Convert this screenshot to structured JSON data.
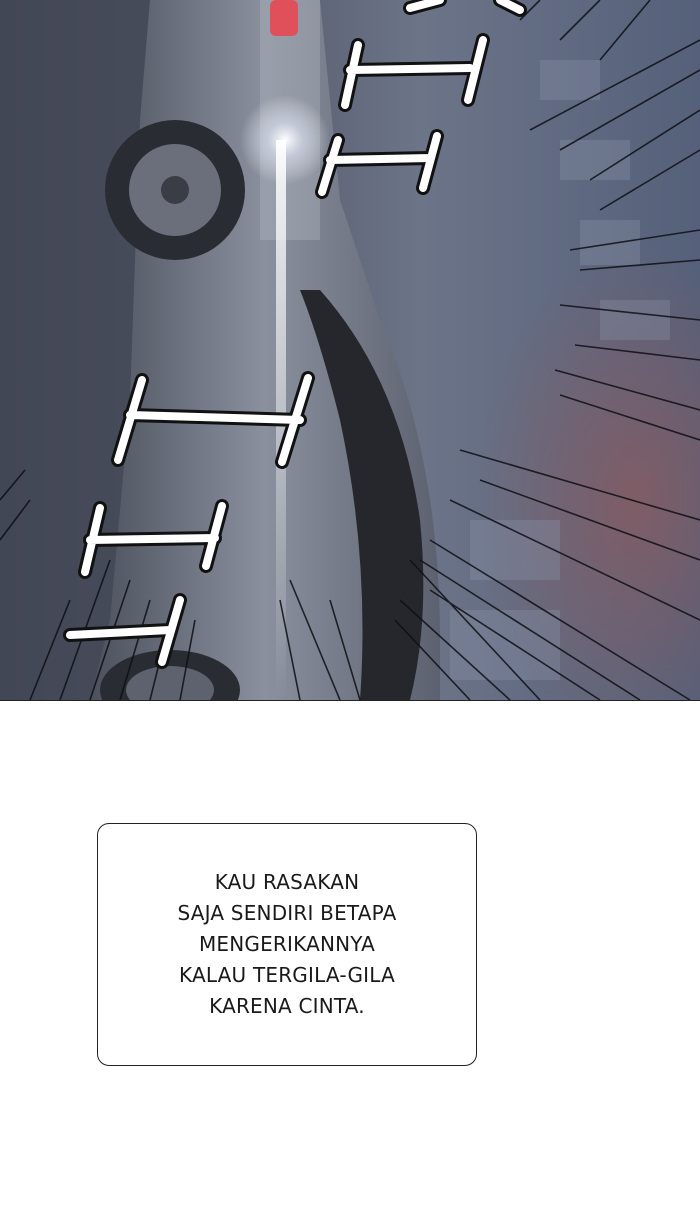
{
  "panel": {
    "scene": "car-speeding-illustration",
    "palette": {
      "background": "#5b6478",
      "road": "#4a4f5c",
      "car_body": "#7b8190",
      "car_dark": "#2a2c33",
      "headlight": "#ffffff",
      "accent_red": "#e0505a",
      "trees": "#8a5a5e"
    }
  },
  "caption": {
    "lines": [
      "KAU RASAKAN",
      "SAJA SENDIRI BETAPA",
      "MENGERIKANNYA",
      "KALAU TERGILA-GILA",
      "KARENA CINTA."
    ]
  }
}
